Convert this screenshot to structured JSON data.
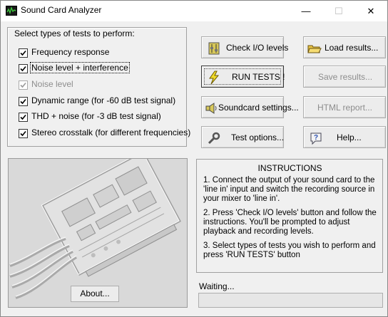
{
  "window": {
    "title": "Sound Card Analyzer",
    "controls": {
      "minimize": "—",
      "maximize": "☐",
      "close": "✕"
    }
  },
  "tests_group": {
    "legend": "Select types of tests to perform:",
    "items": [
      {
        "label": "Frequency response",
        "checked": true,
        "enabled": true
      },
      {
        "label": "Noise level + interference",
        "checked": true,
        "enabled": true
      },
      {
        "label": "Noise level",
        "checked": true,
        "enabled": false
      },
      {
        "label": "Dynamic range (for -60 dB test signal)",
        "checked": true,
        "enabled": true
      },
      {
        "label": "THD + noise (for -3 dB test signal)",
        "checked": true,
        "enabled": true
      },
      {
        "label": "Stereo crosstalk (for different frequencies)",
        "checked": true,
        "enabled": true
      }
    ]
  },
  "buttons": {
    "check_io": "Check I/O levels",
    "load_results": "Load results...",
    "run_tests": "RUN TESTS !",
    "save_results": "Save results...",
    "soundcard_settings": "Soundcard settings...",
    "html_report": "HTML report...",
    "test_options": "Test options...",
    "help": "Help...",
    "about": "About..."
  },
  "instructions": {
    "title": "INSTRUCTIONS",
    "steps": [
      "1. Connect the output of your sound card to the 'line in' input and switch the recording source in your mixer to 'line in'.",
      "2. Press 'Check I/O levels' button and follow the instructions. You'll be prompted to adjust playback and recording levels.",
      "3. Select types of tests you wish to perform and press 'RUN TESTS' button"
    ]
  },
  "status": {
    "text": "Waiting...",
    "progress": 0
  }
}
